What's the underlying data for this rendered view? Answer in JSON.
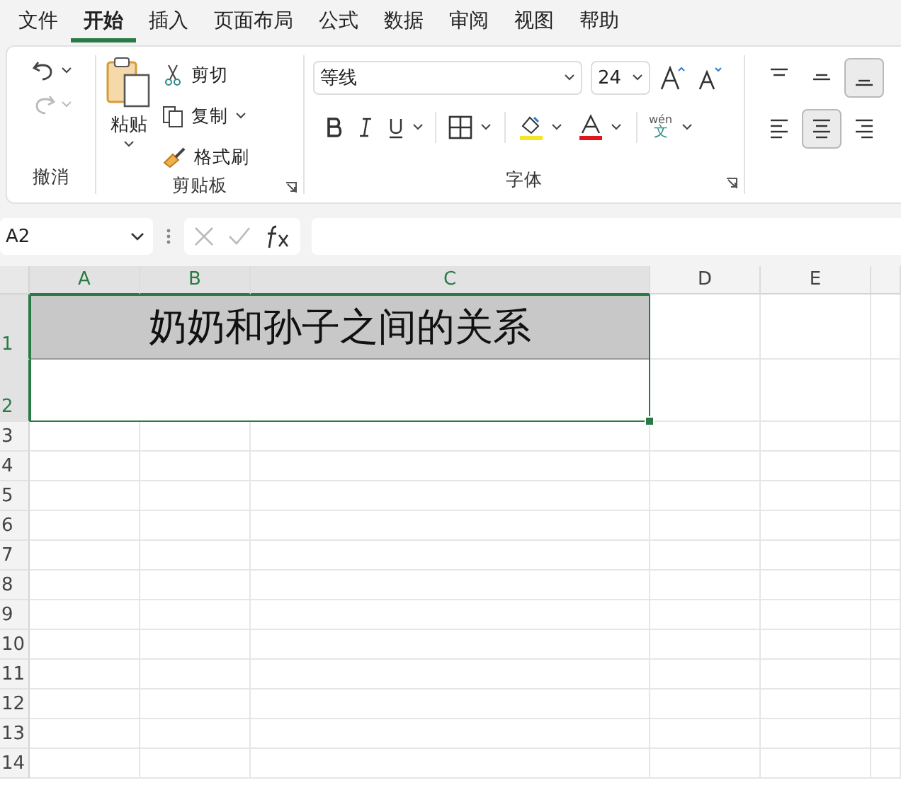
{
  "menu_tabs": [
    {
      "label": "文件",
      "selected": false
    },
    {
      "label": "开始",
      "selected": true
    },
    {
      "label": "插入",
      "selected": false
    },
    {
      "label": "页面布局",
      "selected": false
    },
    {
      "label": "公式",
      "selected": false
    },
    {
      "label": "数据",
      "selected": false
    },
    {
      "label": "审阅",
      "selected": false
    },
    {
      "label": "视图",
      "selected": false
    },
    {
      "label": "帮助",
      "selected": false
    }
  ],
  "ribbon": {
    "undo_group": {
      "label": "撤消",
      "buttons": [
        {
          "kind": "undo",
          "disabled": false
        },
        {
          "kind": "redo",
          "disabled": true
        }
      ]
    },
    "clipboard_group": {
      "label": "剪贴板",
      "paste": "粘贴",
      "items": [
        {
          "kind": "cut",
          "label": "剪切"
        },
        {
          "kind": "copy",
          "label": "复制"
        },
        {
          "kind": "format_painter",
          "label": "格式刷"
        }
      ]
    },
    "font_group": {
      "label": "字体",
      "font_name": "等线",
      "font_size": "24",
      "phonetic_top": "wén",
      "phonetic_bottom": "文"
    },
    "alignment_buttons": [
      {
        "kind": "top",
        "selected": false
      },
      {
        "kind": "middle",
        "selected": false
      },
      {
        "kind": "bottom",
        "selected": true
      },
      {
        "kind": "left",
        "selected": false
      },
      {
        "kind": "center",
        "selected": true
      },
      {
        "kind": "right",
        "selected": false
      }
    ]
  },
  "formula_bar": {
    "name_box": "A2"
  },
  "sheet": {
    "columns": [
      {
        "label": "A",
        "selected": true
      },
      {
        "label": "B",
        "selected": true
      },
      {
        "label": "C",
        "selected": true
      },
      {
        "label": "D",
        "selected": false
      },
      {
        "label": "E",
        "selected": false
      }
    ],
    "rows": [
      {
        "label": "1",
        "selected": true
      },
      {
        "label": "2",
        "selected": true
      },
      {
        "label": "3",
        "selected": false
      },
      {
        "label": "4",
        "selected": false
      },
      {
        "label": "5",
        "selected": false
      },
      {
        "label": "6",
        "selected": false
      },
      {
        "label": "7",
        "selected": false
      },
      {
        "label": "8",
        "selected": false
      },
      {
        "label": "9",
        "selected": false
      },
      {
        "label": "10",
        "selected": false
      },
      {
        "label": "11",
        "selected": false
      },
      {
        "label": "12",
        "selected": false
      },
      {
        "label": "13",
        "selected": false
      },
      {
        "label": "14",
        "selected": false
      }
    ],
    "title_cell": "奶奶和孙子之间的关系"
  }
}
